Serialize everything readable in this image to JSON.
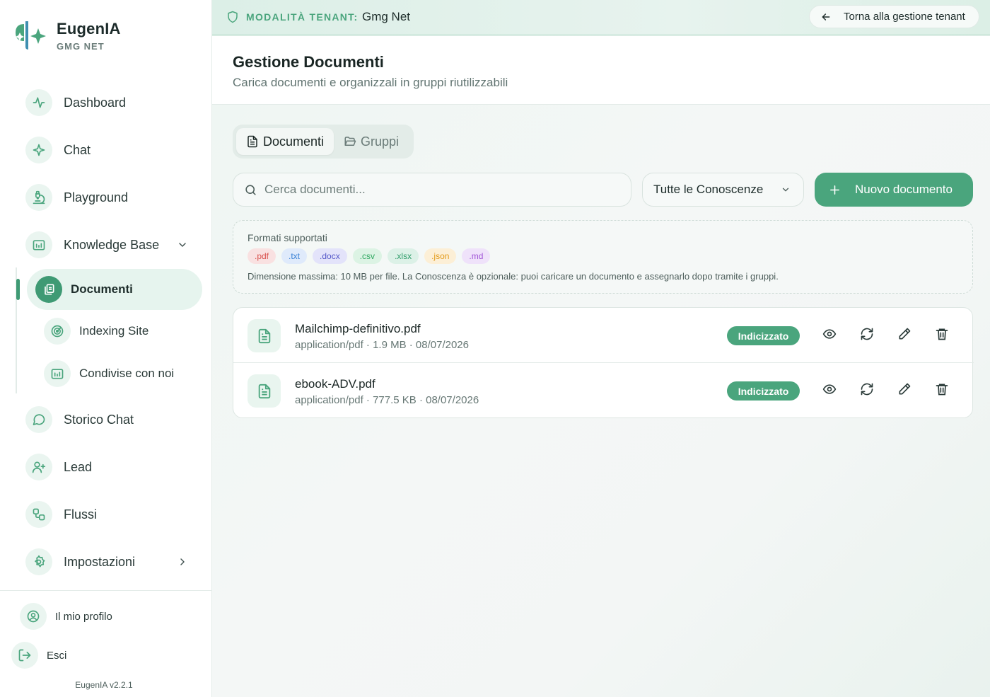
{
  "brand": {
    "name": "EugenIA",
    "sub": "GMG NET"
  },
  "nav": {
    "dashboard": "Dashboard",
    "chat": "Chat",
    "playground": "Playground",
    "knowledge_base": "Knowledge Base",
    "documenti": "Documenti",
    "indexing_site": "Indexing Site",
    "condivise": "Condivise con noi",
    "storico_chat": "Storico Chat",
    "lead": "Lead",
    "flussi": "Flussi",
    "impostazioni": "Impostazioni"
  },
  "footer": {
    "profile": "Il mio profilo",
    "logout": "Esci",
    "version": "EugenIA v2.2.1"
  },
  "topbar": {
    "tenant_label": "MODALITÀ TENANT:",
    "tenant_name": "Gmg Net",
    "back_label": "Torna alla gestione tenant"
  },
  "header": {
    "title": "Gestione Documenti",
    "subtitle": "Carica documenti e organizzali in gruppi riutilizzabili"
  },
  "tabs": {
    "documents": "Documenti",
    "groups": "Gruppi"
  },
  "toolbar": {
    "search_placeholder": "Cerca documenti...",
    "filter_value": "Tutte le Conoscenze",
    "new_label": "Nuovo documento"
  },
  "formats": {
    "title": "Formati supportati",
    "chips": [
      {
        "label": ".pdf",
        "bg": "#f9e1e1",
        "fg": "#d9534f"
      },
      {
        "label": ".txt",
        "bg": "#dfeafb",
        "fg": "#3b82d6"
      },
      {
        "label": ".docx",
        "bg": "#e3e3fa",
        "fg": "#5558c9"
      },
      {
        "label": ".csv",
        "bg": "#dcf3e4",
        "fg": "#2fa860"
      },
      {
        "label": ".xlsx",
        "bg": "#dcf1e7",
        "fg": "#2f9d6a"
      },
      {
        "label": ".json",
        "bg": "#fcefd6",
        "fg": "#e39b1b"
      },
      {
        "label": ".md",
        "bg": "#efe2fa",
        "fg": "#a055d6"
      }
    ],
    "note": "Dimensione massima: 10 MB per file. La Conoscenza è opzionale: puoi caricare un documento e assegnarlo dopo tramite i gruppi."
  },
  "documents": [
    {
      "name": "Mailchimp-definitivo.pdf",
      "meta": "application/pdf · 1.9 MB · 08/07/2026",
      "status": "Indicizzato"
    },
    {
      "name": "ebook-ADV.pdf",
      "meta": "application/pdf · 777.5 KB · 08/07/2026",
      "status": "Indicizzato"
    }
  ],
  "colors": {
    "accent": "#4aa57d",
    "accent_dark": "#3f9a74",
    "accent_light": "#e6f4ee"
  }
}
